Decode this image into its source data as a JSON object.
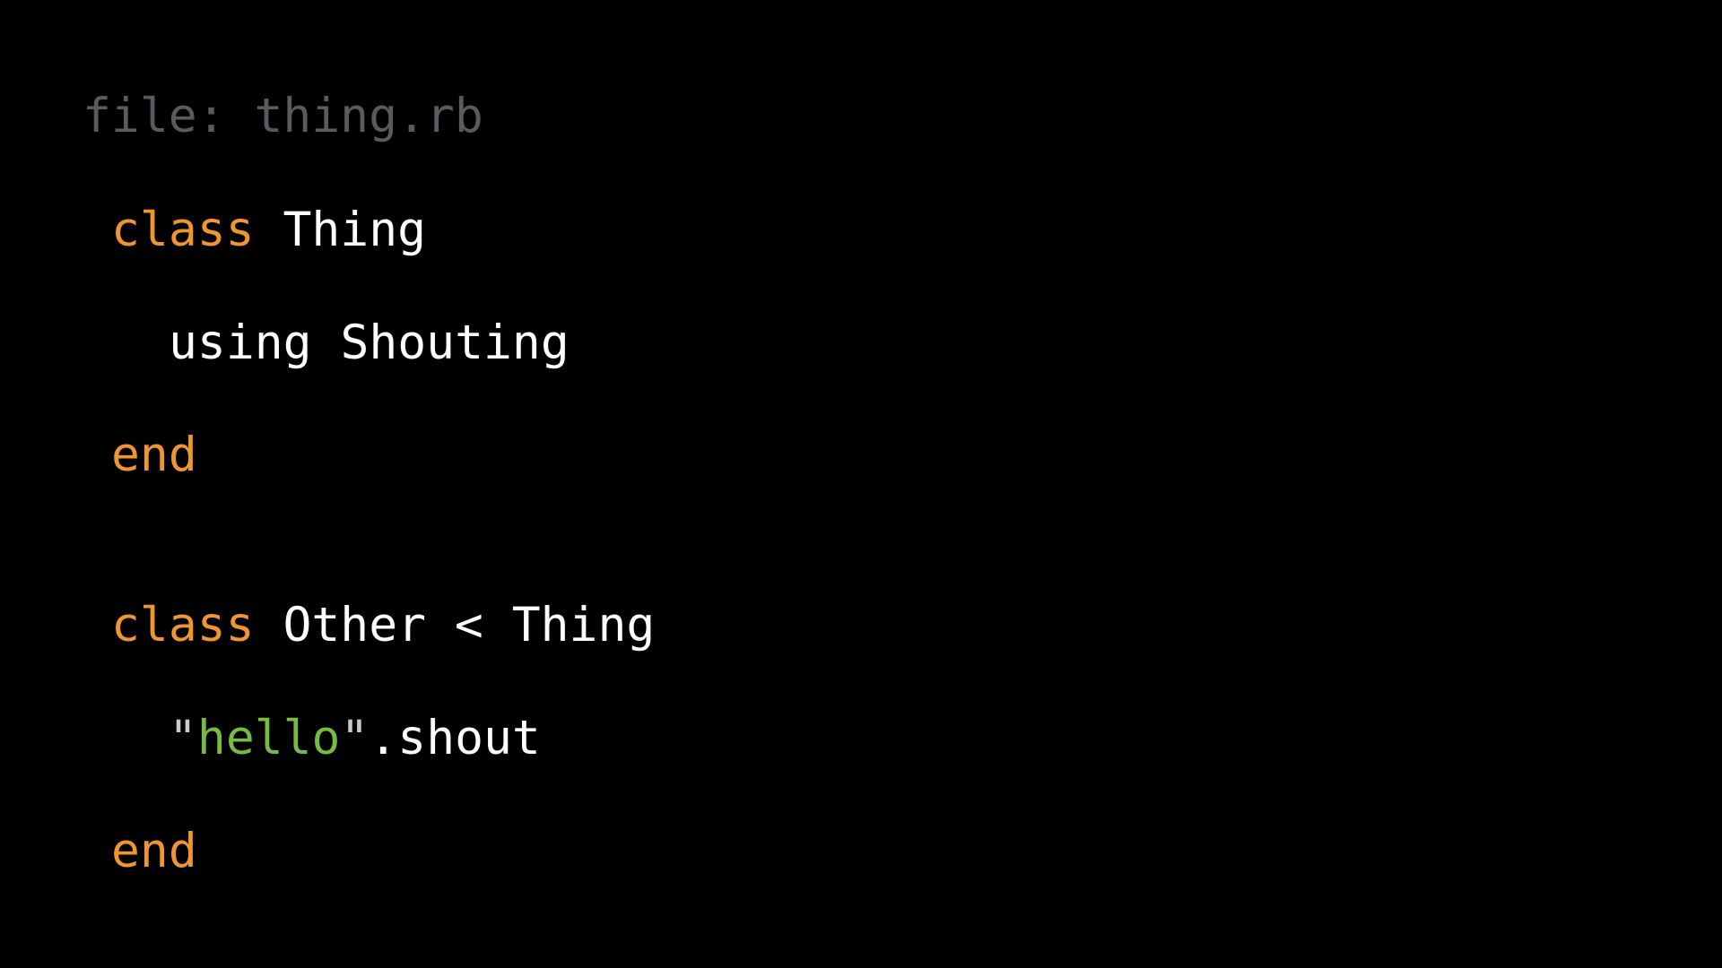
{
  "file_label": "file: thing.rb",
  "code": {
    "line1": {
      "keyword": "class",
      "name": "Thing"
    },
    "line2": {
      "text": "using Shouting"
    },
    "line3": {
      "keyword": "end"
    },
    "line4": {
      "keyword": "class",
      "name": "Other < Thing"
    },
    "line5": {
      "open_quote": "\"",
      "string": "hello",
      "close_quote": "\"",
      "call": ".shout"
    },
    "line6": {
      "keyword": "end"
    }
  },
  "colors": {
    "background": "#000000",
    "keyword": "#ef9631",
    "identifier": "#ffffff",
    "string": "#77bb41",
    "file_label": "#5a5a5f"
  }
}
